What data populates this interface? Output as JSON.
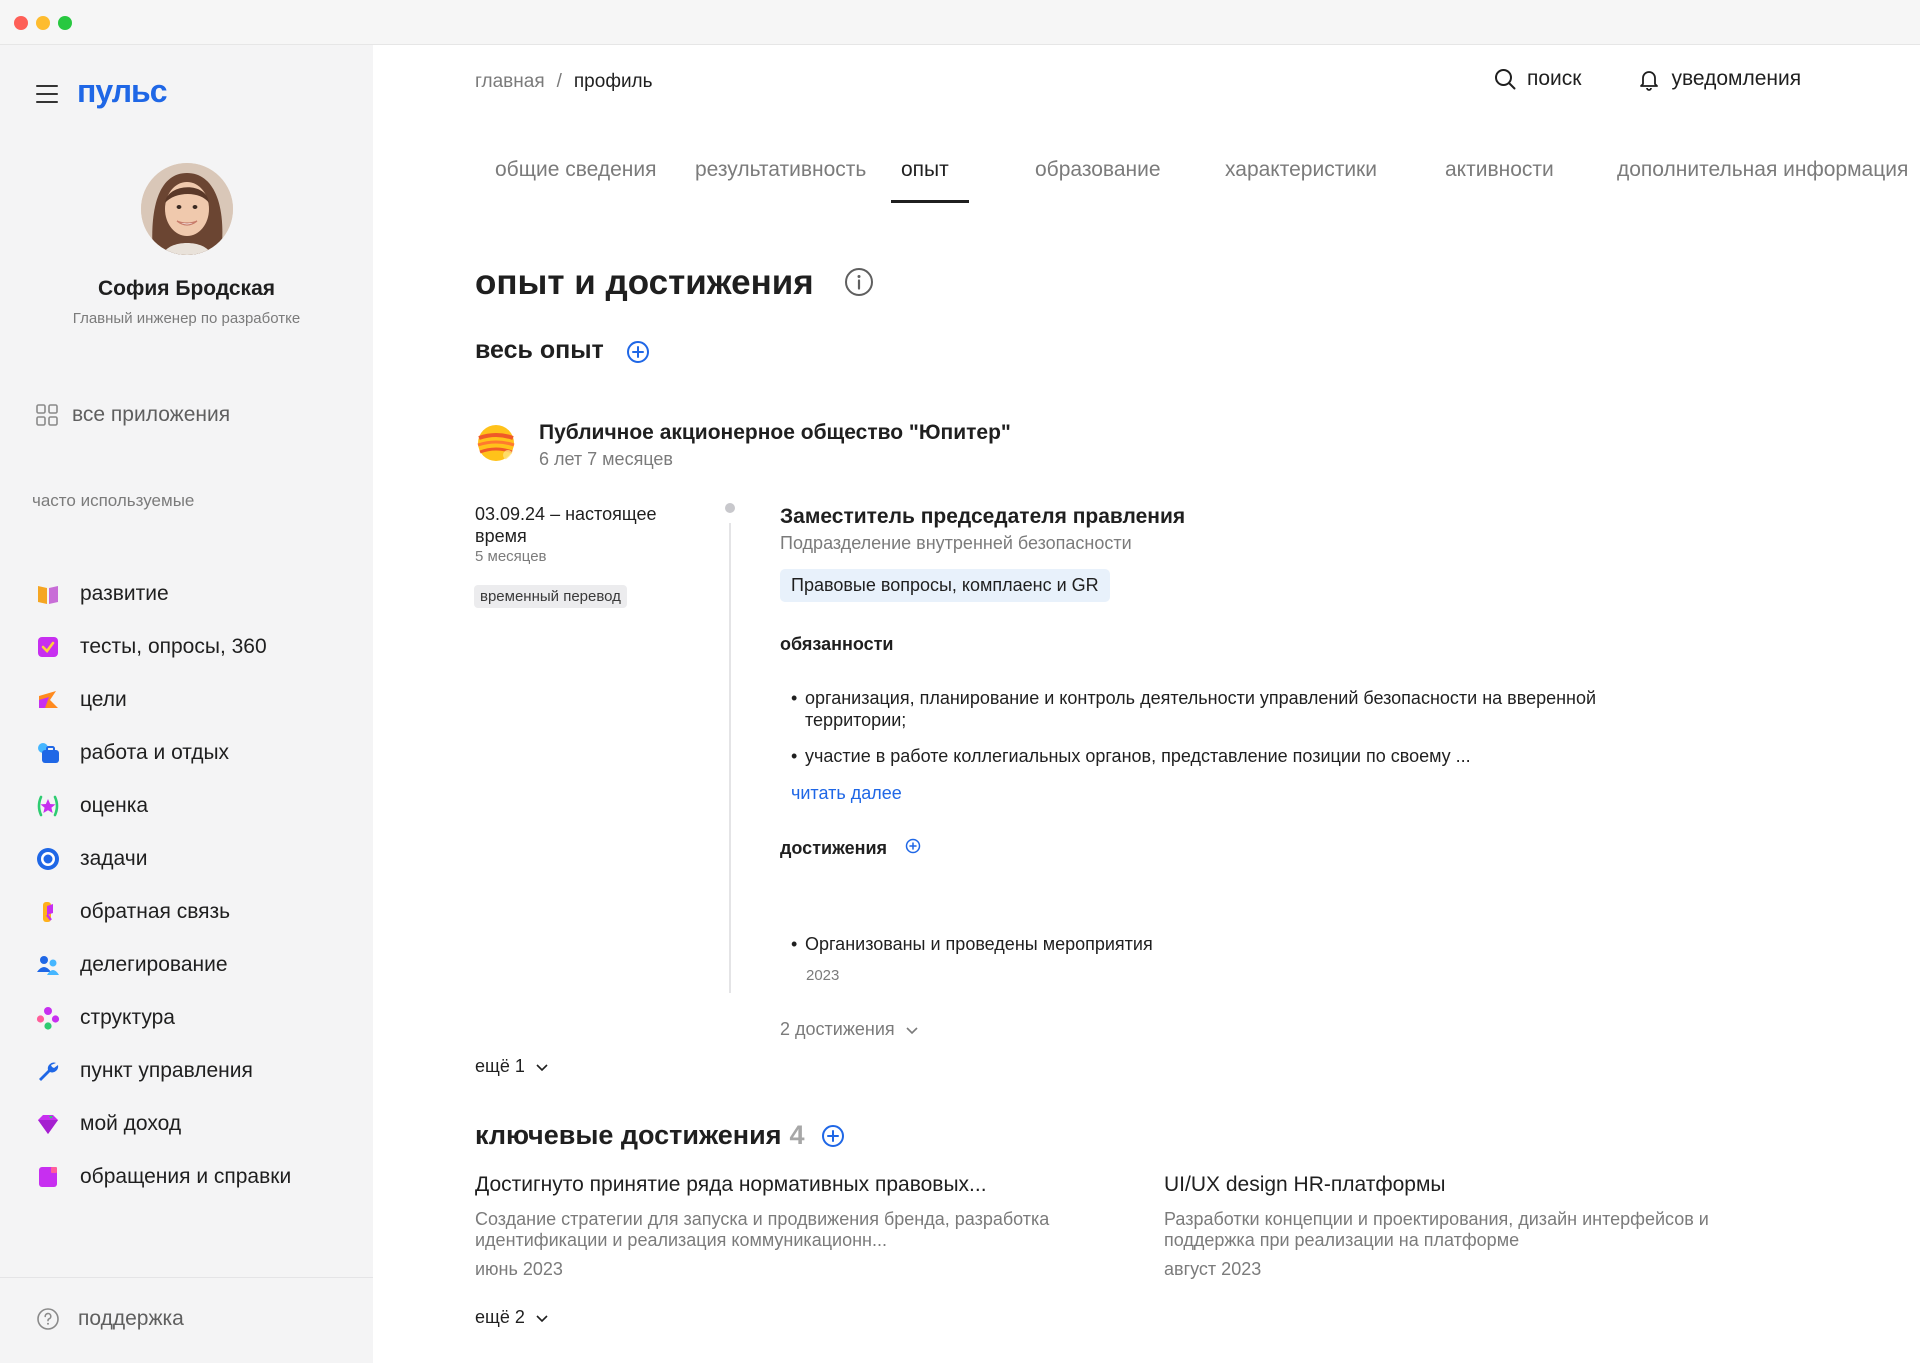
{
  "colors": {
    "accent": "#1f67e6",
    "sidebar_bg": "#f4f4f5",
    "tag_bg": "#e8f1fb"
  },
  "app": {
    "logo_text": "пульс"
  },
  "user": {
    "name": "София Бродская",
    "role": "Главный инженер по разработке"
  },
  "sidebar": {
    "all_apps_label": "все приложения",
    "section_title": "часто используемые",
    "items": [
      {
        "label": "развитие",
        "icon": "book-icon"
      },
      {
        "label": "тесты, опросы, 360",
        "icon": "checkbox-icon"
      },
      {
        "label": "цели",
        "icon": "flag-icon"
      },
      {
        "label": "работа и отдых",
        "icon": "briefcase-icon"
      },
      {
        "label": "оценка",
        "icon": "star-badge-icon"
      },
      {
        "label": "задачи",
        "icon": "target-icon"
      },
      {
        "label": "обратная связь",
        "icon": "feedback-icon"
      },
      {
        "label": "делегирование",
        "icon": "people-icon"
      },
      {
        "label": "структура",
        "icon": "structure-icon"
      },
      {
        "label": "пункт управления",
        "icon": "wrench-icon"
      },
      {
        "label": "мой доход",
        "icon": "gem-icon"
      },
      {
        "label": "обращения и справки",
        "icon": "document-icon"
      }
    ],
    "support_label": "поддержка"
  },
  "header": {
    "breadcrumb": {
      "home": "главная",
      "separator": "/",
      "current": "профиль"
    },
    "search_label": "поиск",
    "notifications_label": "уведомления"
  },
  "tabs": [
    {
      "label": "общие сведения",
      "active": false
    },
    {
      "label": "результативность",
      "active": false
    },
    {
      "label": "опыт",
      "active": true
    },
    {
      "label": "образование",
      "active": false
    },
    {
      "label": "характеристики",
      "active": false
    },
    {
      "label": "активности",
      "active": false
    },
    {
      "label": "дополнительная информация",
      "active": false
    }
  ],
  "page": {
    "title": "опыт и достижения",
    "experience_title": "весь опыт"
  },
  "experience": {
    "company": "Публичное акционерное общество \"Юпитер\"",
    "company_duration": "6 лет 7 месяцев",
    "period": "03.09.24 – настоящее время",
    "period_length": "5 месяцев",
    "badge": "временный перевод",
    "position": "Заместитель председателя правления",
    "department": "Подразделение внутренней безопасности",
    "tag": "Правовые вопросы, комплаенс и GR",
    "duties_title": "обязанности",
    "duties": [
      "организация, планирование и контроль деятельности управлений безопасности на вверенной территории;",
      "участие в работе коллегиальных органов, представление позиции по своему ..."
    ],
    "read_more": "читать далее",
    "achievements_title": "достижения",
    "achievement": "Организованы и проведены мероприятия",
    "achievement_year": "2023",
    "achievements_count": "2 достижения",
    "more": "ещё 1"
  },
  "key_achievements": {
    "title": "ключевые достижения",
    "count": "4",
    "items": [
      {
        "title": "Достигнуто принятие ряда нормативных правовых...",
        "description": "Создание стратегии для запуска и продвижения бренда, разработка идентификации и реализация коммуникационн...",
        "date": "июнь 2023"
      },
      {
        "title": "UI/UX design HR-платформы",
        "description": "Разработки концепции и проектирования, дизайн интерфейсов и поддержка при реализации на платформе",
        "date": "август 2023"
      }
    ],
    "more": "ещё 2"
  }
}
